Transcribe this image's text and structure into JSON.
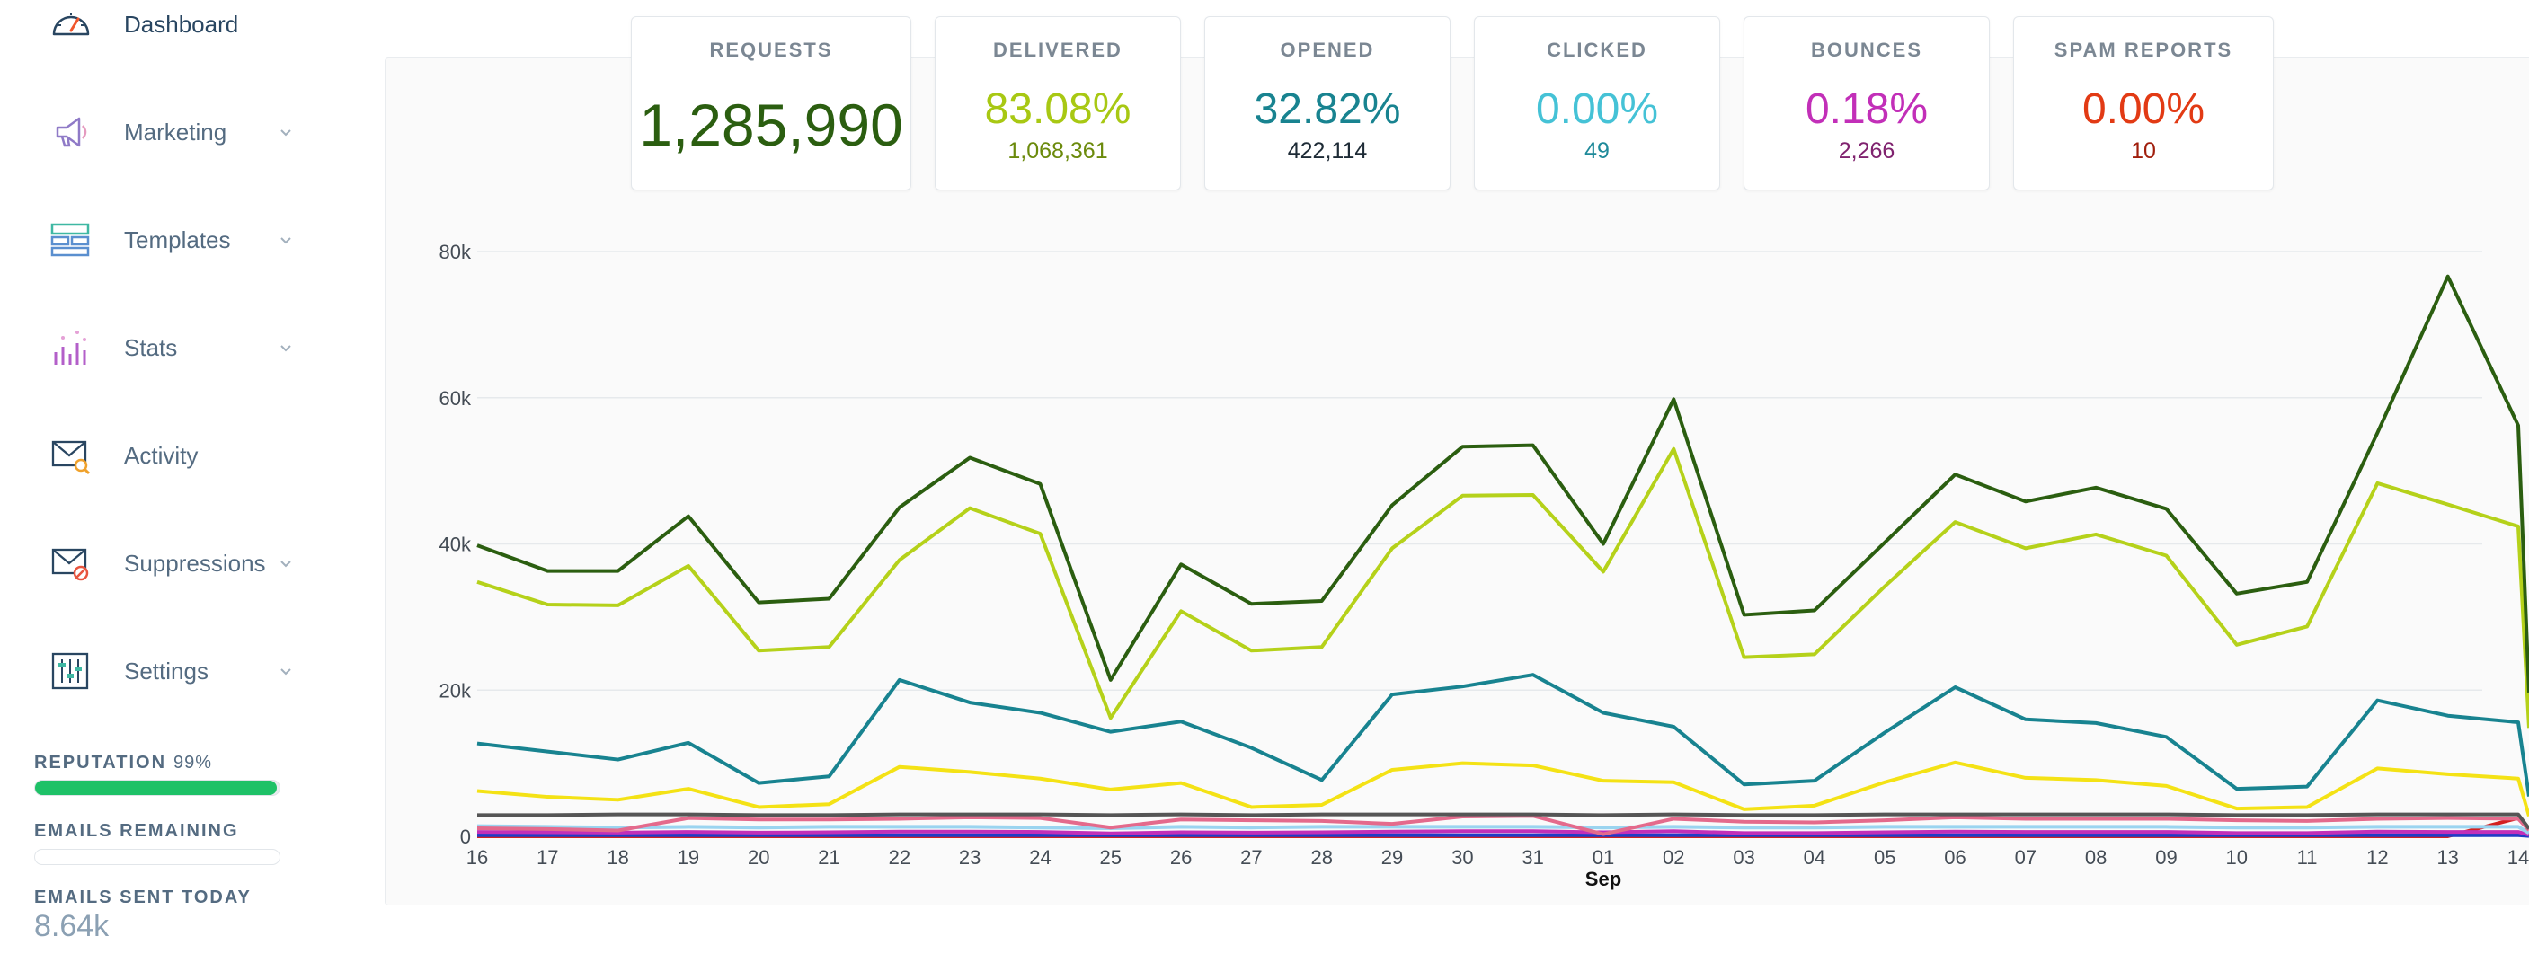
{
  "sidebar": {
    "items": [
      {
        "label": "Dashboard",
        "icon": "speedometer-icon",
        "has_chevron": false,
        "active": true
      },
      {
        "label": "Marketing",
        "icon": "megaphone-icon",
        "has_chevron": true
      },
      {
        "label": "Templates",
        "icon": "template-icon",
        "has_chevron": true
      },
      {
        "label": "Stats",
        "icon": "bar-chart-icon",
        "has_chevron": true
      },
      {
        "label": "Activity",
        "icon": "envelope-search-icon",
        "has_chevron": false
      },
      {
        "label": "Suppressions",
        "icon": "envelope-block-icon",
        "has_chevron": true
      },
      {
        "label": "Settings",
        "icon": "sliders-icon",
        "has_chevron": true
      }
    ],
    "reputation_label": "REPUTATION",
    "reputation_value": "99%",
    "reputation_fraction": 0.99,
    "emails_remaining_label": "EMAILS REMAINING",
    "emails_sent_today_label": "EMAILS SENT TODAY",
    "emails_sent_today_value": "8.64k"
  },
  "stats": {
    "requests": {
      "title": "REQUESTS",
      "value": "1,285,990",
      "color": "#2b5e10"
    },
    "delivered": {
      "title": "DELIVERED",
      "pct": "83.08%",
      "count": "1,068,361",
      "color": "#a8c813",
      "count_color": "#6b8a0c"
    },
    "opened": {
      "title": "OPENED",
      "pct": "32.82%",
      "count": "422,114",
      "color": "#188390",
      "count_color": "#1e2b36"
    },
    "clicked": {
      "title": "CLICKED",
      "pct": "0.00%",
      "count": "49",
      "color": "#45c2d6",
      "count_color": "#1f8a9a"
    },
    "bounces": {
      "title": "BOUNCES",
      "pct": "0.18%",
      "count": "2,266",
      "color": "#c22fb8",
      "count_color": "#80236f"
    },
    "spam": {
      "title": "SPAM REPORTS",
      "pct": "0.00%",
      "count": "10",
      "color": "#e23a14",
      "count_color": "#a01e0c"
    }
  },
  "chart_data": {
    "type": "line",
    "x": [
      "16",
      "17",
      "18",
      "19",
      "20",
      "21",
      "22",
      "23",
      "24",
      "25",
      "26",
      "27",
      "28",
      "29",
      "30",
      "31",
      "01",
      "02",
      "03",
      "04",
      "05",
      "06",
      "07",
      "08",
      "09",
      "10",
      "11",
      "12",
      "13",
      "14"
    ],
    "x_month_label": "Sep",
    "y_ticks": [
      "0",
      "20k",
      "40k",
      "60k",
      "80k"
    ],
    "ylim": [
      0,
      80000
    ],
    "grid": true,
    "series": [
      {
        "color": "#2b5e10",
        "values": [
          39800,
          36300,
          36300,
          43800,
          32000,
          32500,
          45000,
          51800,
          48200,
          21400,
          37200,
          31800,
          32200,
          45300,
          53300,
          53500,
          40000,
          59800,
          30300,
          30900,
          40200,
          49500,
          45800,
          47700,
          44800,
          33200,
          34800,
          55200,
          76600,
          56200
        ]
      },
      {
        "color": "#b5d11a",
        "values": [
          34800,
          31700,
          31600,
          37000,
          25400,
          25900,
          37800,
          44900,
          41400,
          16200,
          30800,
          25400,
          25900,
          39400,
          46600,
          46700,
          36200,
          53000,
          24500,
          24900,
          34200,
          43000,
          39400,
          41300,
          38400,
          26200,
          28700,
          48300,
          45400,
          42400
        ]
      },
      {
        "color": "#188390",
        "values": [
          12700,
          11600,
          10500,
          12800,
          7300,
          8200,
          21400,
          18300,
          16900,
          14300,
          15700,
          12100,
          7700,
          19400,
          20500,
          22100,
          16900,
          15000,
          7100,
          7600,
          14200,
          20400,
          16000,
          15500,
          13600,
          6500,
          6800,
          18600,
          16500,
          15600
        ]
      },
      {
        "color": "#f4e215",
        "values": [
          6200,
          5400,
          5000,
          6500,
          4000,
          4400,
          9500,
          8800,
          7900,
          6400,
          7300,
          4000,
          4300,
          9100,
          10000,
          9700,
          7600,
          7400,
          3700,
          4200,
          7400,
          10100,
          8000,
          7700,
          6900,
          3800,
          4000,
          9300,
          8500,
          7900
        ]
      },
      {
        "color": "#555555",
        "values": [
          2900,
          2900,
          3000,
          3000,
          2900,
          2900,
          3000,
          3000,
          3000,
          2900,
          3000,
          2900,
          3000,
          3000,
          3000,
          3000,
          2900,
          3000,
          2900,
          2900,
          3000,
          3000,
          3000,
          3000,
          3000,
          2900,
          2900,
          3000,
          3000,
          3000
        ]
      },
      {
        "color": "#e46a8c",
        "values": [
          1100,
          1000,
          800,
          2500,
          2300,
          2300,
          2400,
          2600,
          2500,
          1200,
          2300,
          2200,
          2100,
          1700,
          2700,
          2800,
          300,
          2400,
          2000,
          1900,
          2200,
          2600,
          2400,
          2400,
          2400,
          2200,
          2100,
          2400,
          2500,
          2400
        ]
      },
      {
        "color": "#9ad4f0",
        "values": [
          1400,
          1300,
          1200,
          1300,
          1200,
          1300,
          1300,
          1300,
          1200,
          1100,
          1300,
          1200,
          1300,
          1300,
          1300,
          1300,
          1200,
          1300,
          1200,
          1200,
          1300,
          1300,
          1300,
          1300,
          1300,
          1200,
          1200,
          1300,
          1300,
          1300
        ]
      },
      {
        "color": "#c22fb8",
        "values": [
          600,
          550,
          500,
          600,
          500,
          550,
          650,
          650,
          600,
          400,
          550,
          500,
          550,
          650,
          700,
          700,
          550,
          700,
          450,
          450,
          550,
          650,
          600,
          600,
          600,
          450,
          450,
          650,
          600,
          600
        ]
      },
      {
        "color": "#1f3cc6",
        "values": [
          150,
          150,
          150,
          150,
          150,
          150,
          150,
          150,
          150,
          150,
          150,
          150,
          150,
          150,
          150,
          150,
          150,
          150,
          150,
          150,
          150,
          150,
          150,
          150,
          150,
          150,
          150,
          150,
          150,
          150
        ]
      },
      {
        "color": "#d32020",
        "values": [
          0,
          0,
          0,
          0,
          0,
          0,
          0,
          0,
          0,
          0,
          0,
          0,
          0,
          0,
          0,
          0,
          0,
          0,
          0,
          0,
          0,
          0,
          0,
          0,
          0,
          0,
          0,
          0,
          0,
          2500
        ]
      }
    ]
  }
}
